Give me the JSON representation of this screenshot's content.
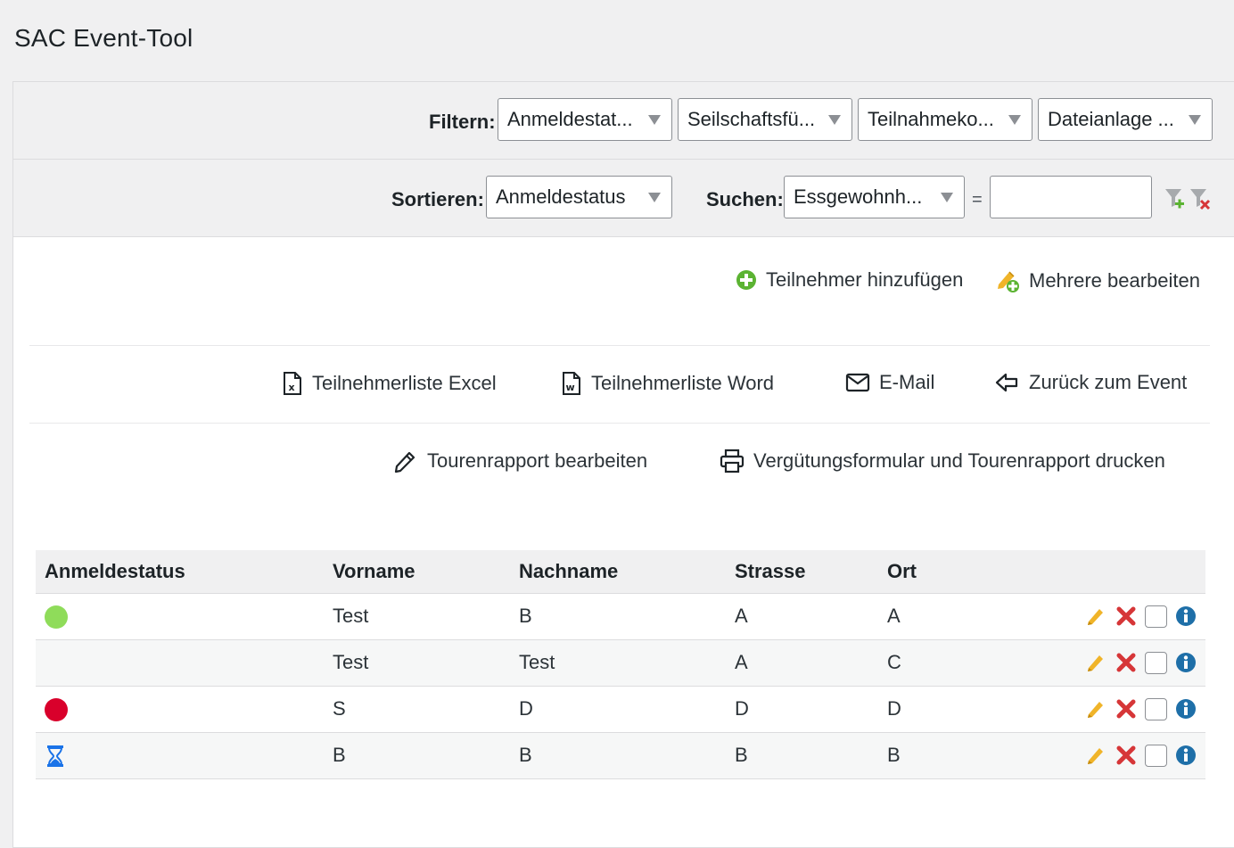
{
  "app": {
    "title": "SAC Event-Tool"
  },
  "filter": {
    "label": "Filtern:",
    "selects": [
      "Anmeldestat...",
      "Seilschaftsfü...",
      "Teilnahmeko...",
      "Dateianlage ..."
    ]
  },
  "sort": {
    "label": "Sortieren:",
    "value": "Anmeldestatus",
    "search_label": "Suchen:",
    "search_field": "Essgewohnh...",
    "equals": "=",
    "search_value": ""
  },
  "actions": {
    "add_participant": "Teilnehmer hinzufügen",
    "edit_multiple": "Mehrere bearbeiten",
    "excel_list": "Teilnehmerliste Excel",
    "word_list": "Teilnehmerliste Word",
    "email": "E-Mail",
    "back_to_event": "Zurück zum Event",
    "edit_report": "Tourenrapport bearbeiten",
    "print_report": "Vergütungsformular und Tourenrapport drucken"
  },
  "table": {
    "columns": [
      "Anmeldestatus",
      "Vorname",
      "Nachname",
      "Strasse",
      "Ort"
    ],
    "rows": [
      {
        "status": "green-dot",
        "vorname": "Test",
        "nachname": "B",
        "strasse": "A",
        "ort": "A"
      },
      {
        "status": "",
        "vorname": "Test",
        "nachname": "Test",
        "strasse": "A",
        "ort": "C"
      },
      {
        "status": "red-dot",
        "vorname": "S",
        "nachname": "D",
        "strasse": "D",
        "ort": "D"
      },
      {
        "status": "hourglass-icon",
        "vorname": "B",
        "nachname": "B",
        "strasse": "B",
        "ort": "B"
      }
    ]
  },
  "colors": {
    "status_green": "#8fdc5a",
    "status_red": "#d9002b",
    "waiting_blue": "#1a73e8",
    "edit_orange": "#f0b429",
    "delete_red": "#d63638",
    "info_blue": "#1e6fa8",
    "add_green": "#5bb332"
  }
}
